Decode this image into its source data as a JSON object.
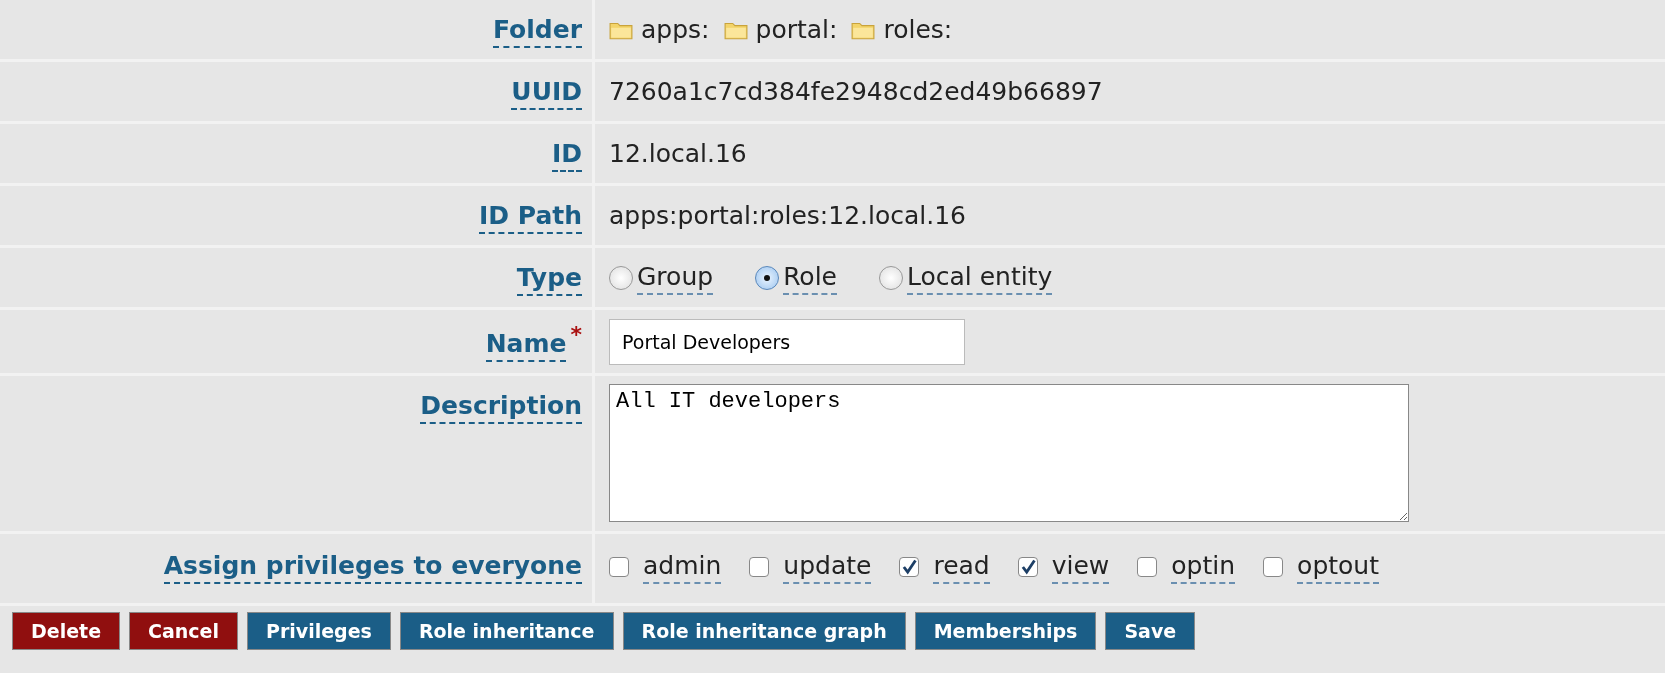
{
  "fields": [
    {
      "label": "Folder",
      "kind": "folder",
      "path": [
        "apps:",
        "portal:",
        "roles:"
      ]
    },
    {
      "label": "UUID",
      "kind": "text",
      "value": "7260a1c7cd384fe2948cd2ed49b66897"
    },
    {
      "label": "ID",
      "kind": "text",
      "value": "12.local.16"
    },
    {
      "label": "ID Path",
      "kind": "text",
      "value": "apps:portal:roles:12.local.16"
    },
    {
      "label": "Type",
      "kind": "radio",
      "options": [
        {
          "label": "Group",
          "selected": false
        },
        {
          "label": "Role",
          "selected": true
        },
        {
          "label": "Local entity",
          "selected": false
        }
      ]
    },
    {
      "label": "Name",
      "kind": "input",
      "required": "*",
      "value": "Portal Developers"
    },
    {
      "label": "Description",
      "kind": "textarea",
      "value": "All IT developers"
    },
    {
      "label": "Assign privileges to everyone",
      "kind": "checks",
      "options": [
        {
          "label": "admin",
          "checked": false
        },
        {
          "label": "update",
          "checked": false
        },
        {
          "label": "read",
          "checked": true
        },
        {
          "label": "view",
          "checked": true
        },
        {
          "label": "optin",
          "checked": false
        },
        {
          "label": "optout",
          "checked": false
        }
      ]
    }
  ],
  "buttons": [
    {
      "label": "Delete",
      "kind": "danger"
    },
    {
      "label": "Cancel",
      "kind": "danger"
    },
    {
      "label": "Privileges",
      "kind": "primary"
    },
    {
      "label": "Role inheritance",
      "kind": "primary"
    },
    {
      "label": "Role inheritance graph",
      "kind": "primary"
    },
    {
      "label": "Memberships",
      "kind": "primary"
    },
    {
      "label": "Save",
      "kind": "primary"
    }
  ]
}
